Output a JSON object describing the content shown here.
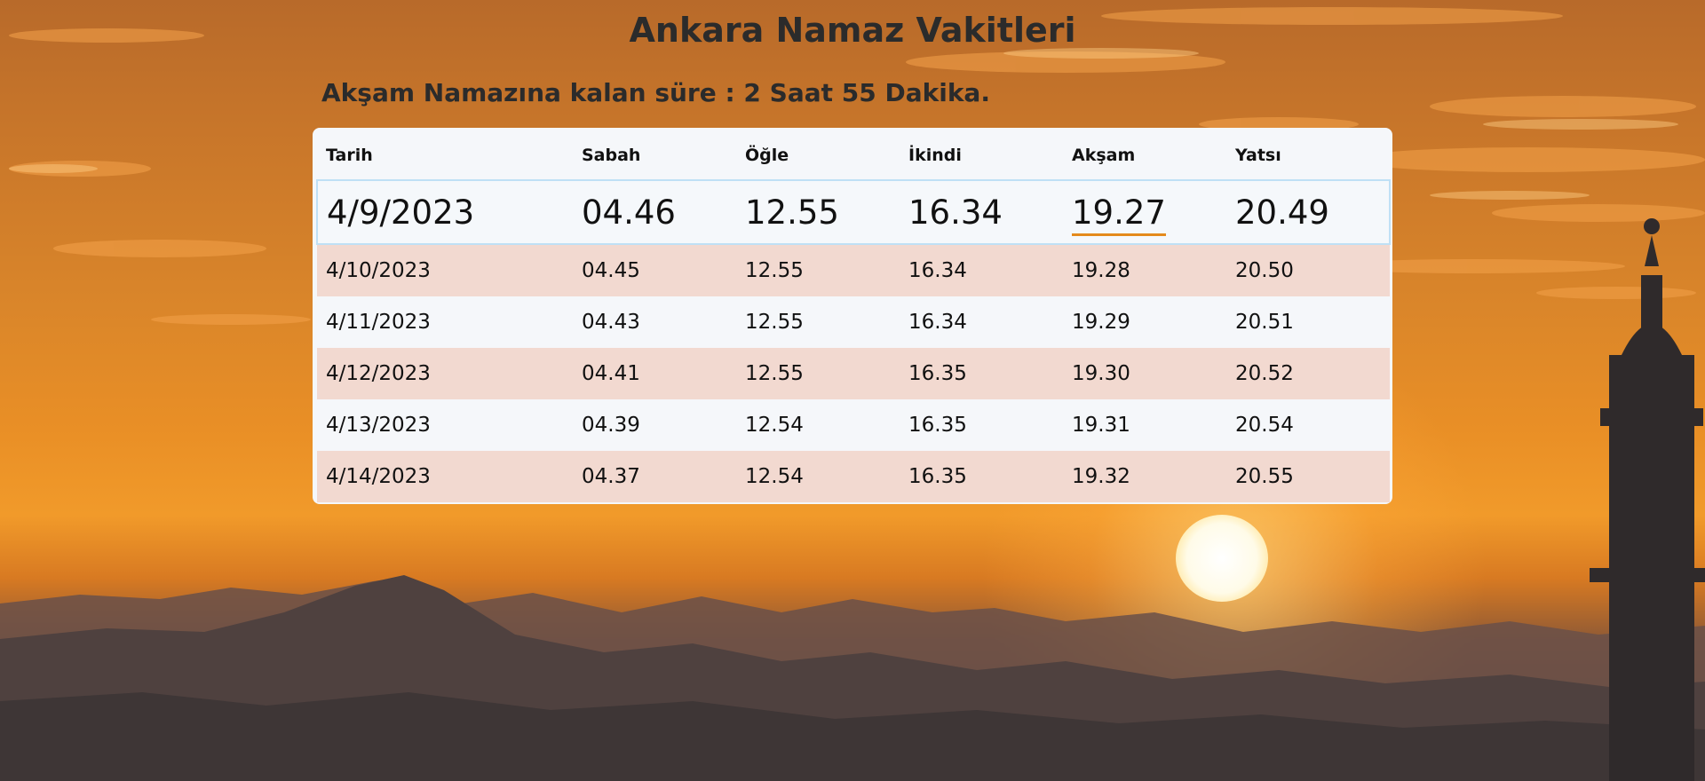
{
  "page": {
    "title": "Ankara Namaz Vakitleri",
    "countdown": "Akşam Namazına kalan süre : 2 Saat 55 Dakika."
  },
  "table": {
    "headers": [
      "Tarih",
      "Sabah",
      "Öğle",
      "İkindi",
      "Akşam",
      "Yatsı"
    ],
    "rows": [
      [
        "4/9/2023",
        "04.46",
        "12.55",
        "16.34",
        "19.27",
        "20.49"
      ],
      [
        "4/10/2023",
        "04.45",
        "12.55",
        "16.34",
        "19.28",
        "20.50"
      ],
      [
        "4/11/2023",
        "04.43",
        "12.55",
        "16.34",
        "19.29",
        "20.51"
      ],
      [
        "4/12/2023",
        "04.41",
        "12.55",
        "16.35",
        "19.30",
        "20.52"
      ],
      [
        "4/13/2023",
        "04.39",
        "12.54",
        "16.35",
        "19.31",
        "20.54"
      ],
      [
        "4/14/2023",
        "04.37",
        "12.54",
        "16.35",
        "19.32",
        "20.55"
      ]
    ]
  },
  "colors": {
    "accent_underline": "#e48a1c",
    "stripe_row": "#f2d9d0",
    "current_row_border": "#bfe0f5"
  }
}
